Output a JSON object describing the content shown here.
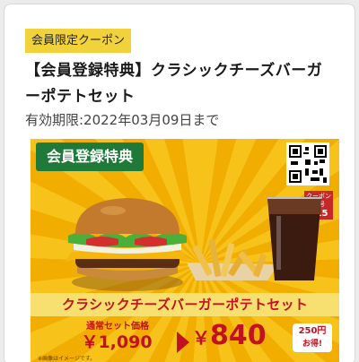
{
  "badge": "会員限定クーポン",
  "title": "【会員登録特典】クラシックチーズバーガーポテトセット",
  "expiry": "有効期限:2022年03月09日まで",
  "coupon": {
    "member_tab": "会員登録特典",
    "code_label": "クーポン番号",
    "code": "715",
    "product_name": "クラシックチーズバーガーポテトセット",
    "regular_label": "通常セット価格",
    "regular_price": "￥1,090",
    "sale_yen": "￥",
    "sale_price": "840",
    "discount_amount": "250円",
    "discount_suffix": "お得!",
    "note": "※画像はイメージです。"
  },
  "colors": {
    "badge_bg": "#f2d23a",
    "coupon_bg": "#f4b400",
    "tab_green": "#1f7a3a",
    "price_red": "#c1121f"
  }
}
